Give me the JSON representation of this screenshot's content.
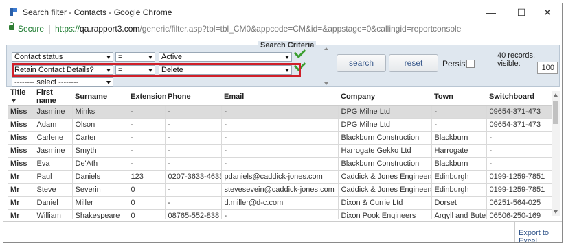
{
  "window": {
    "title": "Search filter - Contacts - Google Chrome",
    "minimize_glyph": "—",
    "maximize_glyph": "☐",
    "close_glyph": "✕"
  },
  "address": {
    "secure_label": "Secure",
    "url_scheme": "https://",
    "url_host": "qa.rapport3.com",
    "url_rest": "/generic/filter.asp?tbl=tbl_CM0&appcode=CM&id=&appstage=0&callingid=reportconsole"
  },
  "criteria": {
    "title": "Search Criteria",
    "rows": [
      {
        "field": "Contact status",
        "operator": "=",
        "value": "Active"
      },
      {
        "field": "Retain Contact Details?",
        "operator": "=",
        "value": "Delete"
      }
    ],
    "new_field_placeholder": "-------- select --------",
    "search_label": "search",
    "reset_label": "reset",
    "persist_label": "Persist",
    "records_text": "40 records, visible:",
    "visible_value": "100",
    "highlight_color": "#d0202a",
    "check_color": "#3a9e2f"
  },
  "table": {
    "columns": [
      "Title",
      "First name",
      "Surname",
      "Extension",
      "Phone",
      "Email",
      "Company",
      "Town",
      "Switchboard"
    ],
    "rows": [
      [
        "Miss",
        "Jasmine",
        "Minks",
        "-",
        "-",
        "-",
        "DPG Milne Ltd",
        "-",
        "09654-371-473"
      ],
      [
        "Miss",
        "Adam",
        "Olson",
        "-",
        "-",
        "-",
        "DPG Milne Ltd",
        "-",
        "09654-371-473"
      ],
      [
        "Miss",
        "Carlene",
        "Carter",
        "-",
        "-",
        "-",
        "Blackburn Construction",
        "Blackburn",
        "-"
      ],
      [
        "Miss",
        "Jasmine",
        "Smyth",
        "-",
        "-",
        "-",
        "Harrogate Gekko Ltd",
        "Harrogate",
        "-"
      ],
      [
        "Miss",
        "Eva",
        "De'Ath",
        "-",
        "-",
        "-",
        "Blackburn Construction",
        "Blackburn",
        "-"
      ],
      [
        "Mr",
        "Paul",
        "Daniels",
        "123",
        "0207-3633-4633",
        "pdaniels@caddick-jones.com",
        "Caddick & Jones Engineers",
        "Edinburgh",
        "0199-1259-7851"
      ],
      [
        "Mr",
        "Steve",
        "Severin",
        "0",
        "-",
        "stevesevein@caddick-jones.com",
        "Caddick & Jones Engineers",
        "Edinburgh",
        "0199-1259-7851"
      ],
      [
        "Mr",
        "Daniel",
        "Miller",
        "0",
        "-",
        "d.miller@d-c.com",
        "Dixon & Currie Ltd",
        "Dorset",
        "06251-564-025"
      ],
      [
        "Mr",
        "William",
        "Shakespeare",
        "0",
        "08765-552-838",
        "-",
        "Dixon Pook Engineers",
        "Argyll and Bute",
        "06506-250-169"
      ]
    ]
  },
  "footer": {
    "export_label": "Export to Excel"
  }
}
